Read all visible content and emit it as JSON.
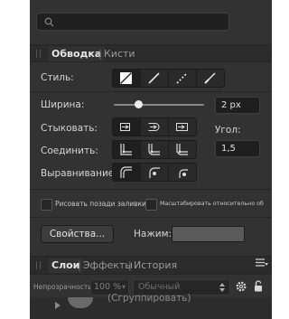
{
  "search": {
    "placeholder": ""
  },
  "stroke_panel": {
    "tabs": [
      {
        "label": "Обводка"
      },
      {
        "label": "Кисти"
      }
    ],
    "style_label": "Стиль:",
    "width_label": "Ширина:",
    "width_value": "2 px",
    "width_slider_level": 0.27,
    "cap_label": "Стыковать:",
    "join_label": "Соединить:",
    "align_label": "Выравнивание:",
    "angle_label": "Угол:",
    "angle_value": "1,5",
    "draw_behind_label": "Рисовать позади заливки",
    "scale_label": "Масштабировать относительно об",
    "properties_button": "Свойства...",
    "pressure_label": "Нажим:"
  },
  "layers_panel": {
    "tabs": [
      {
        "label": "Слои"
      },
      {
        "label": "Эффекты"
      },
      {
        "label": "История"
      }
    ],
    "opacity_label": "Непрозрачность:",
    "opacity_value": "100 %",
    "blend_mode": "Обычный",
    "layer_name": "(Сгруппировать)"
  },
  "colors": {
    "panel_bg": "#323232",
    "field_bg": "#1e1e1e",
    "text": "#d4d4d4"
  }
}
